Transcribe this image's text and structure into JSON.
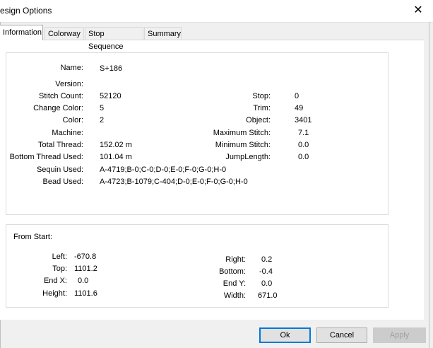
{
  "window": {
    "title": "esign Options",
    "close_glyph": "✕"
  },
  "tabs": [
    "Information",
    "Colorway",
    "Stop Sequence",
    "Summary"
  ],
  "info": {
    "name": {
      "label": "Name:",
      "value": "S+186"
    },
    "version": {
      "label": "Version:",
      "value": ""
    },
    "stitch_count": {
      "label": "Stitch Count:",
      "value": "52120"
    },
    "change_color": {
      "label": "Change Color:",
      "value": "5"
    },
    "color": {
      "label": "Color:",
      "value": "2"
    },
    "machine": {
      "label": "Machine:",
      "value": ""
    },
    "total_thread": {
      "label": "Total Thread:",
      "value": "152.02 m"
    },
    "bottom_thread": {
      "label": "Bottom Thread Used:",
      "value": "101.04 m"
    },
    "sequin": {
      "label": "Sequin Used:",
      "value": "A-4719;B-0;C-0;D-0;E-0;F-0;G-0;H-0"
    },
    "bead": {
      "label": "Bead Used:",
      "value": "A-4723;B-1079;C-404;D-0;E-0;F-0;G-0;H-0"
    },
    "stop": {
      "label": "Stop:",
      "value": "0"
    },
    "trim": {
      "label": "Trim:",
      "value": "49"
    },
    "object": {
      "label": "Object:",
      "value": "3401"
    },
    "max_stitch": {
      "label": "Maximum Stitch:",
      "value": "7.1"
    },
    "min_stitch": {
      "label": "Minimum Stitch:",
      "value": "0.0"
    },
    "jump_length": {
      "label": "JumpLength:",
      "value": "0.0"
    }
  },
  "from_start": {
    "heading": "From Start:",
    "left": {
      "label": "Left:",
      "value": "-670.8"
    },
    "top": {
      "label": "Top:",
      "value": "1101.2"
    },
    "end_x": {
      "label": "End X:",
      "value": "0.0"
    },
    "height": {
      "label": "Height:",
      "value": "1101.6"
    },
    "right": {
      "label": "Right:",
      "value": "0.2"
    },
    "bottom": {
      "label": "Bottom:",
      "value": "-0.4"
    },
    "end_y": {
      "label": "End Y:",
      "value": "0.0"
    },
    "width": {
      "label": "Width:",
      "value": "671.0"
    }
  },
  "buttons": {
    "ok": "Ok",
    "cancel": "Cancel",
    "apply": "Apply"
  }
}
